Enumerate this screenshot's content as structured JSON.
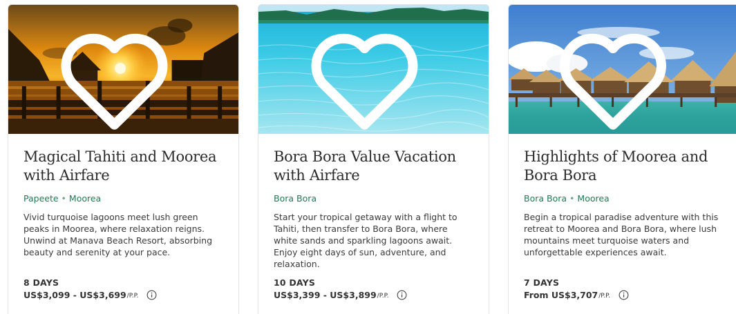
{
  "cards": [
    {
      "title": "Magical Tahiti and Moorea with Airfare",
      "locations": [
        "Papeete",
        "Moorea"
      ],
      "description": "Vivid turquoise lagoons meet lush green peaks in Moorea, where relaxation reigns. Unwind at Manava Beach Resort, absorbing beauty and serenity at your pace.",
      "duration": "8 DAYS",
      "price": "US$3,099 - US$3,699",
      "price_unit": "/P.P.",
      "image": "sunset-overwater-bungalows"
    },
    {
      "title": "Bora Bora Value Vacation with Airfare",
      "locations": [
        "Bora Bora"
      ],
      "description": "Start your tropical getaway with a flight to Tahiti, then transfer to Bora Bora, where white sands and sparkling lagoons await. Enjoy eight days of sun, adventure, and relaxation.",
      "duration": "10 DAYS",
      "price": "US$3,399 - US$3,899",
      "price_unit": "/P.P.",
      "image": "turquoise-lagoon"
    },
    {
      "title": "Highlights of Moorea and Bora Bora",
      "locations": [
        "Bora Bora",
        "Moorea"
      ],
      "description": "Begin a tropical paradise adventure with this retreat to Moorea and Bora Bora, where lush mountains meet turquoise waters and unforgettable experiences await.",
      "duration": "7 DAYS",
      "price": "From US$3,707",
      "price_unit": "/P.P.",
      "image": "overwater-bungalows-day"
    }
  ],
  "colors": {
    "location_green": "#1e7a55",
    "title": "#2b2b2b",
    "border": "#e4e4e4"
  },
  "icons": {
    "favorite": "heart-outline-icon",
    "info": "info-circle-icon"
  }
}
